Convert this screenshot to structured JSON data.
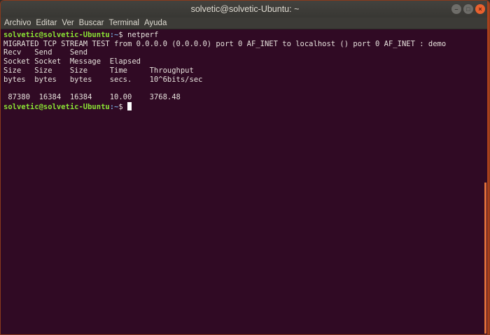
{
  "window": {
    "title": "solvetic@solvetic-Ubuntu: ~"
  },
  "menu": [
    "Archivo",
    "Editar",
    "Ver",
    "Buscar",
    "Terminal",
    "Ayuda"
  ],
  "terminal": {
    "prompt_user": "solvetic@solvetic-Ubuntu",
    "prompt_path": ":~",
    "prompt_sym": "$ ",
    "command": "netperf",
    "lines": [
      "MIGRATED TCP STREAM TEST from 0.0.0.0 (0.0.0.0) port 0 AF_INET to localhost () port 0 AF_INET : demo",
      "Recv   Send    Send",
      "Socket Socket  Message  Elapsed",
      "Size   Size    Size     Time     Throughput",
      "bytes  bytes   bytes    secs.    10^6bits/sec",
      "",
      " 87380  16384  16384    10.00    3768.48"
    ]
  }
}
